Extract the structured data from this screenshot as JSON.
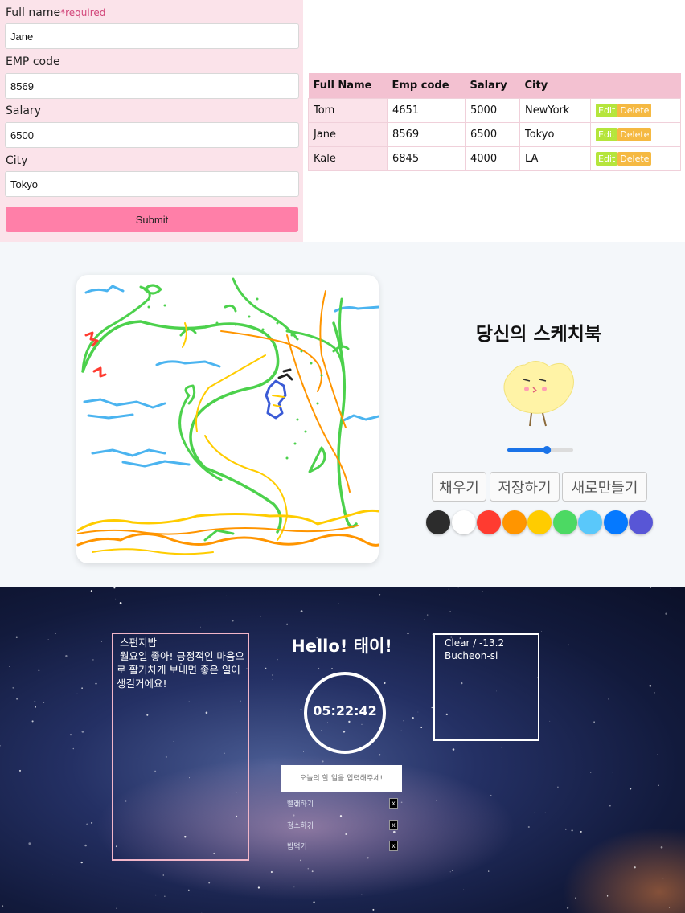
{
  "employee_form": {
    "full_name_label": "Full name",
    "required_label": "*required",
    "full_name_value": "Jane",
    "emp_code_label": "EMP code",
    "emp_code_value": "8569",
    "salary_label": "Salary",
    "salary_value": "6500",
    "city_label": "City",
    "city_value": "Tokyo",
    "submit_label": "Submit"
  },
  "employee_table": {
    "headers": [
      "Full Name",
      "Emp code",
      "Salary",
      "City"
    ],
    "rows": [
      {
        "name": "Tom",
        "code": "4651",
        "salary": "5000",
        "city": "NewYork"
      },
      {
        "name": "Jane",
        "code": "8569",
        "salary": "6500",
        "city": "Tokyo"
      },
      {
        "name": "Kale",
        "code": "6845",
        "salary": "4000",
        "city": "LA"
      }
    ],
    "edit_label": "Edit",
    "delete_label": "Delete"
  },
  "sketchbook": {
    "title": "당신의 스케치북",
    "brush_size": 0.6,
    "buttons": {
      "fill": "채우기",
      "save": "저장하기",
      "new": "새로만들기"
    },
    "palette": [
      "#2c2c2c",
      "#ffffff",
      "#ff3b30",
      "#ff9500",
      "#ffcc00",
      "#4cd963",
      "#5ac8fa",
      "#0579ff",
      "#5856d6"
    ]
  },
  "momentum": {
    "quote": " 스펀지밥\n 월요일 좋아! 긍정적인 마음으로 활기차게 보내면 좋은 일이 생길거에요!",
    "greeting": "Hello! 태이!",
    "clock": "05:22:42",
    "todo_placeholder": "오늘의 할 일을 입력해주세!",
    "todos": [
      "빨래하기",
      "청소하기",
      "밥먹기"
    ],
    "todo_delete_label": "x",
    "weather": "Clear / -13.2",
    "location": "Bucheon-si"
  }
}
